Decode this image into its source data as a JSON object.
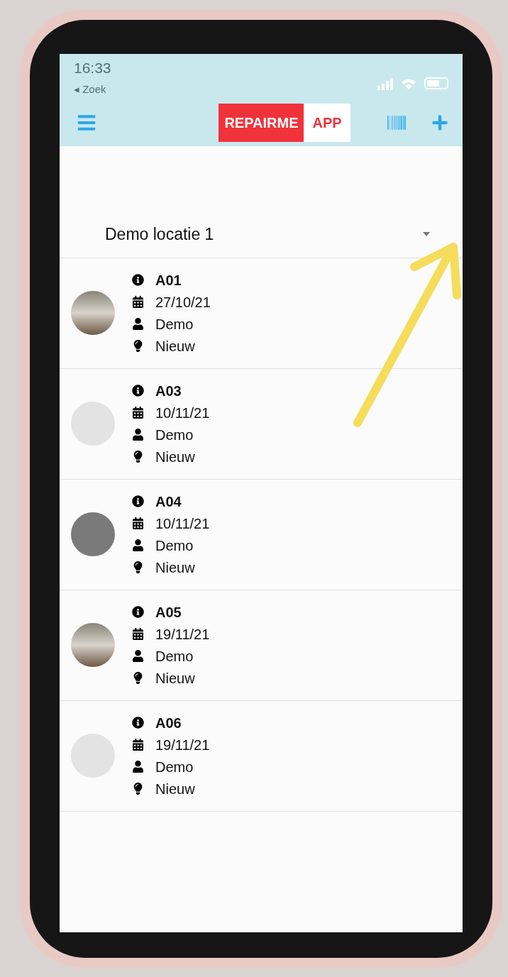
{
  "status_bar": {
    "time": "16:33",
    "back_label": "◂ Zoek"
  },
  "header": {
    "logo_left": "REPAIRME",
    "logo_right": "APP"
  },
  "location_select": {
    "value": "Demo locatie 1"
  },
  "repairs": [
    {
      "code": "A01",
      "date": "27/10/21",
      "user": "Demo",
      "status": "Nieuw",
      "kind": "photo"
    },
    {
      "code": "A03",
      "date": "10/11/21",
      "user": "Demo",
      "status": "Nieuw",
      "kind": "empty"
    },
    {
      "code": "A04",
      "date": "10/11/21",
      "user": "Demo",
      "status": "Nieuw",
      "kind": "dark"
    },
    {
      "code": "A05",
      "date": "19/11/21",
      "user": "Demo",
      "status": "Nieuw",
      "kind": "photo"
    },
    {
      "code": "A06",
      "date": "19/11/21",
      "user": "Demo",
      "status": "Nieuw",
      "kind": "empty"
    }
  ]
}
